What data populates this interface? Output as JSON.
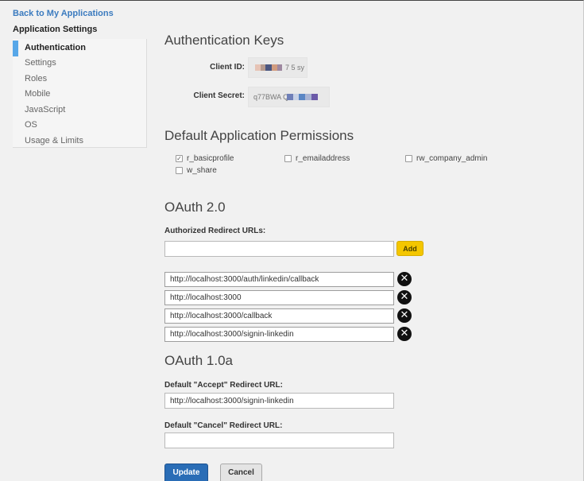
{
  "nav": {
    "back_link": "Back to My Applications",
    "section_title": "Application Settings",
    "items": [
      {
        "label": "Authentication",
        "active": true
      },
      {
        "label": "Settings"
      },
      {
        "label": "Roles"
      },
      {
        "label": "Mobile"
      },
      {
        "label": "JavaScript"
      },
      {
        "label": "OS"
      },
      {
        "label": "Usage & Limits"
      }
    ]
  },
  "auth_keys": {
    "heading": "Authentication Keys",
    "client_id_label": "Client ID:",
    "client_id_value": "7 5 sy k",
    "client_secret_label": "Client Secret:",
    "client_secret_value": "q77BWA           Q"
  },
  "permissions": {
    "heading": "Default Application Permissions",
    "items": [
      {
        "label": "r_basicprofile",
        "checked": true
      },
      {
        "label": "r_emailaddress",
        "checked": false
      },
      {
        "label": "rw_company_admin",
        "checked": false
      },
      {
        "label": "w_share",
        "checked": false
      }
    ]
  },
  "oauth2": {
    "heading": "OAuth 2.0",
    "redirect_label": "Authorized Redirect URLs:",
    "new_url_value": "",
    "add_button": "Add",
    "urls": [
      "http://localhost:3000/auth/linkedin/callback",
      "http://localhost:3000",
      "http://localhost:3000/callback",
      "http://localhost:3000/signin-linkedin"
    ],
    "remove_glyph": "✕"
  },
  "oauth1": {
    "heading": "OAuth 1.0a",
    "accept_label": "Default \"Accept\" Redirect URL:",
    "accept_value": "http://localhost:3000/signin-linkedin",
    "cancel_label": "Default \"Cancel\" Redirect URL:",
    "cancel_value": ""
  },
  "actions": {
    "update": "Update",
    "cancel": "Cancel"
  },
  "colors": {
    "link": "#3b7bbf",
    "active_marker": "#57a7e8",
    "add_button": "#f4c600",
    "update_button": "#2a6db6"
  }
}
